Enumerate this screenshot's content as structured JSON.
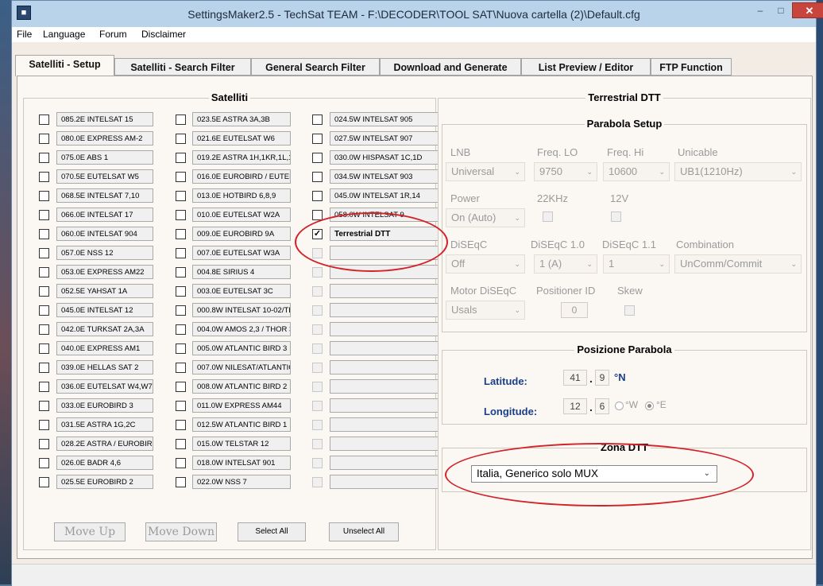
{
  "window": {
    "title": "SettingsMaker2.5 - TechSat TEAM - F:\\DECODER\\TOOL SAT\\Nuova cartella (2)\\Default.cfg",
    "minimize": "–",
    "maximize": "□",
    "close": "✕"
  },
  "menu": [
    "File",
    "Language",
    "Forum",
    "Disclaimer"
  ],
  "tabs": [
    "Satelliti - Setup",
    "Satelliti - Search Filter",
    "General Search Filter",
    "Download and Generate",
    "List Preview / Editor",
    "FTP Function"
  ],
  "satelliti": {
    "title": "Satelliti",
    "col1": [
      "085.2E INTELSAT 15",
      "080.0E EXPRESS AM-2",
      "075.0E ABS 1",
      "070.5E EUTELSAT W5",
      "068.5E INTELSAT 7,10",
      "066.0E INTELSAT 17",
      "060.0E INTELSAT 904",
      "057.0E NSS 12",
      "053.0E EXPRESS AM22",
      "052.5E YAHSAT 1A",
      "045.0E INTELSAT 12",
      "042.0E TURKSAT 2A,3A",
      "040.0E EXPRESS AM1",
      "039.0E HELLAS SAT 2",
      "036.0E EUTELSAT W4,W7",
      "033.0E EUROBIRD 3",
      "031.5E ASTRA 1G,2C",
      "028.2E ASTRA / EUROBIRD",
      "026.0E BADR 4,6",
      "025.5E EUROBIRD 2"
    ],
    "col2": [
      "023.5E ASTRA 3A,3B",
      "021.6E EUTELSAT W6",
      "019.2E ASTRA 1H,1KR,1L,1",
      "016.0E EUROBIRD / EUTEL",
      "013.0E HOTBIRD 6,8,9",
      "010.0E EUTELSAT W2A",
      "009.0E EUROBIRD 9A",
      "007.0E EUTELSAT W3A",
      "004.8E SIRIUS 4",
      "003.0E EUTELSAT 3C",
      "000.8W INTELSAT 10-02/TH",
      "004.0W AMOS 2,3 / THOR 3",
      "005.0W ATLANTIC BIRD 3",
      "007.0W NILESAT/ATLANTIC",
      "008.0W ATLANTIC BIRD 2",
      "011.0W EXPRESS AM44",
      "012.5W ATLANTIC BIRD 1",
      "015.0W TELSTAR 12",
      "018.0W INTELSAT 901",
      "022.0W NSS 7"
    ],
    "col3": [
      "024.5W INTELSAT 905",
      "027.5W INTELSAT 907",
      "030.0W HISPASAT 1C,1D",
      "034.5W INTELSAT 903",
      "045.0W INTELSAT 1R,14",
      "058.0W INTELSAT 9",
      "Terrestrial DTT"
    ],
    "checked": "✓",
    "buttons": {
      "move_up": "Move Up",
      "move_down": "Move Down",
      "select_all": "Select All",
      "unselect_all": "Unselect All"
    }
  },
  "terrestrial": {
    "title": "Terrestrial DTT",
    "parabola_setup": {
      "title": "Parabola Setup",
      "lnb_label": "LNB",
      "lnb_value": "Universal",
      "freq_lo_label": "Freq. LO",
      "freq_lo_value": "9750",
      "freq_hi_label": "Freq. Hi",
      "freq_hi_value": "10600",
      "unicable_label": "Unicable",
      "unicable_value": "UB1(1210Hz)",
      "power_label": "Power",
      "power_value": "On (Auto)",
      "khz_label": "22KHz",
      "v12_label": "12V",
      "diseqc_label": "DiSEqC",
      "diseqc_value": "Off",
      "diseqc10_label": "DiSEqC 1.0",
      "diseqc10_value": "1 (A)",
      "diseqc11_label": "DiSEqC 1.1",
      "diseqc11_value": "1",
      "combination_label": "Combination",
      "combination_value": "UnComm/Commit",
      "motor_label": "Motor DiSEqC",
      "motor_value": "Usals",
      "positioner_label": "Positioner ID",
      "positioner_value": "0",
      "skew_label": "Skew"
    },
    "posizione": {
      "title": "Posizione Parabola",
      "lat_label": "Latitude:",
      "lat_deg": "41",
      "lat_min": "9",
      "lat_dir": "°N",
      "lon_label": "Longitude:",
      "lon_deg": "12",
      "lon_min": "6",
      "w_label": "°W",
      "e_label": "°E",
      "sep": "."
    },
    "zona": {
      "title": "Zona DTT",
      "value": "Italia, Generico solo MUX"
    }
  },
  "colors": {
    "annotation": "#d3232a",
    "label_blue": "#1a3f8a"
  }
}
